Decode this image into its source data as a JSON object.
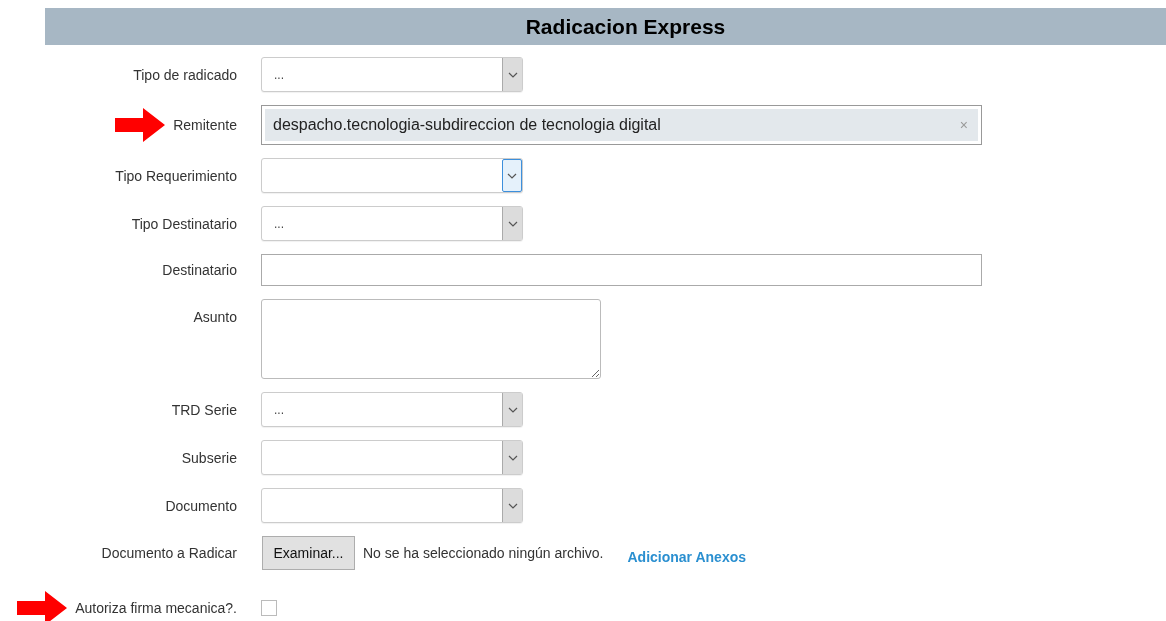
{
  "title": "Radicacion Express",
  "fields": [
    {
      "kind": "select",
      "label": "Tipo de radicado",
      "value": "...",
      "focused": false,
      "arrow": false
    },
    {
      "kind": "tag",
      "label": "Remitente",
      "value": "despacho.tecnologia-subdireccion de tecnologia digital",
      "clear": "×",
      "arrow": true
    },
    {
      "kind": "select",
      "label": "Tipo Requerimiento",
      "focused": true,
      "arrow": false
    },
    {
      "kind": "select",
      "label": "Tipo Destinatario",
      "value": "...",
      "focused": false,
      "arrow": false
    },
    {
      "kind": "text",
      "label": "Destinatario",
      "arrow": false
    },
    {
      "kind": "textarea",
      "label": "Asunto",
      "arrow": false
    },
    {
      "kind": "select",
      "label": "TRD Serie",
      "value": "...",
      "focused": false,
      "arrow": false
    },
    {
      "kind": "select",
      "label": "Subserie",
      "focused": false,
      "arrow": false
    },
    {
      "kind": "select",
      "label": "Documento",
      "focused": false,
      "arrow": false
    },
    {
      "kind": "file",
      "label": "Documento a Radicar",
      "button": "Examinar...",
      "status": "No se ha seleccionado ningún archivo.",
      "link": "Adicionar Anexos",
      "arrow": false
    },
    {
      "kind": "checkbox",
      "label": "Autoriza firma mecanica?.",
      "checked": false,
      "arrow": true
    }
  ]
}
